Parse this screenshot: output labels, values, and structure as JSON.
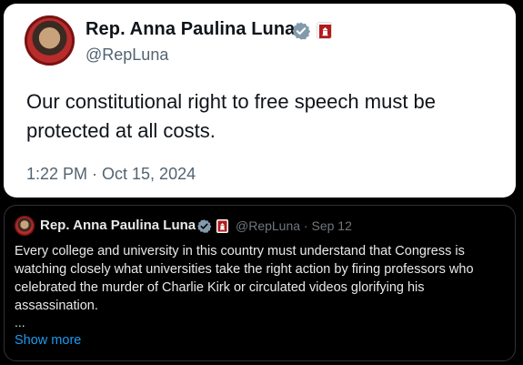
{
  "main_tweet": {
    "name": "Rep. Anna Paulina Luna",
    "handle": "@RepLuna",
    "text": "Our constitutional right to free speech must be protected at all costs.",
    "timestamp": "1:22 PM · Oct 15, 2024",
    "avatar_icon": "profile-photo",
    "verified_icon": "verified-badge",
    "affiliation_icon": "us-house-badge"
  },
  "quoted_tweet": {
    "name": "Rep. Anna Paulina Luna",
    "handle_date": "@RepLuna · Sep 12",
    "text": "Every college and university in this country must understand that Congress is watching closely what universities take the right action by firing professors who celebrated the murder of Charlie Kirk or circulated videos glorifying his assassination.",
    "ellipsis": "...",
    "show_more": "Show more",
    "avatar_icon": "profile-photo",
    "verified_icon": "verified-badge",
    "affiliation_icon": "us-house-badge"
  },
  "colors": {
    "verified": "#829aab",
    "link": "#1d9bf0",
    "gov_badge": "#b31b1b"
  }
}
